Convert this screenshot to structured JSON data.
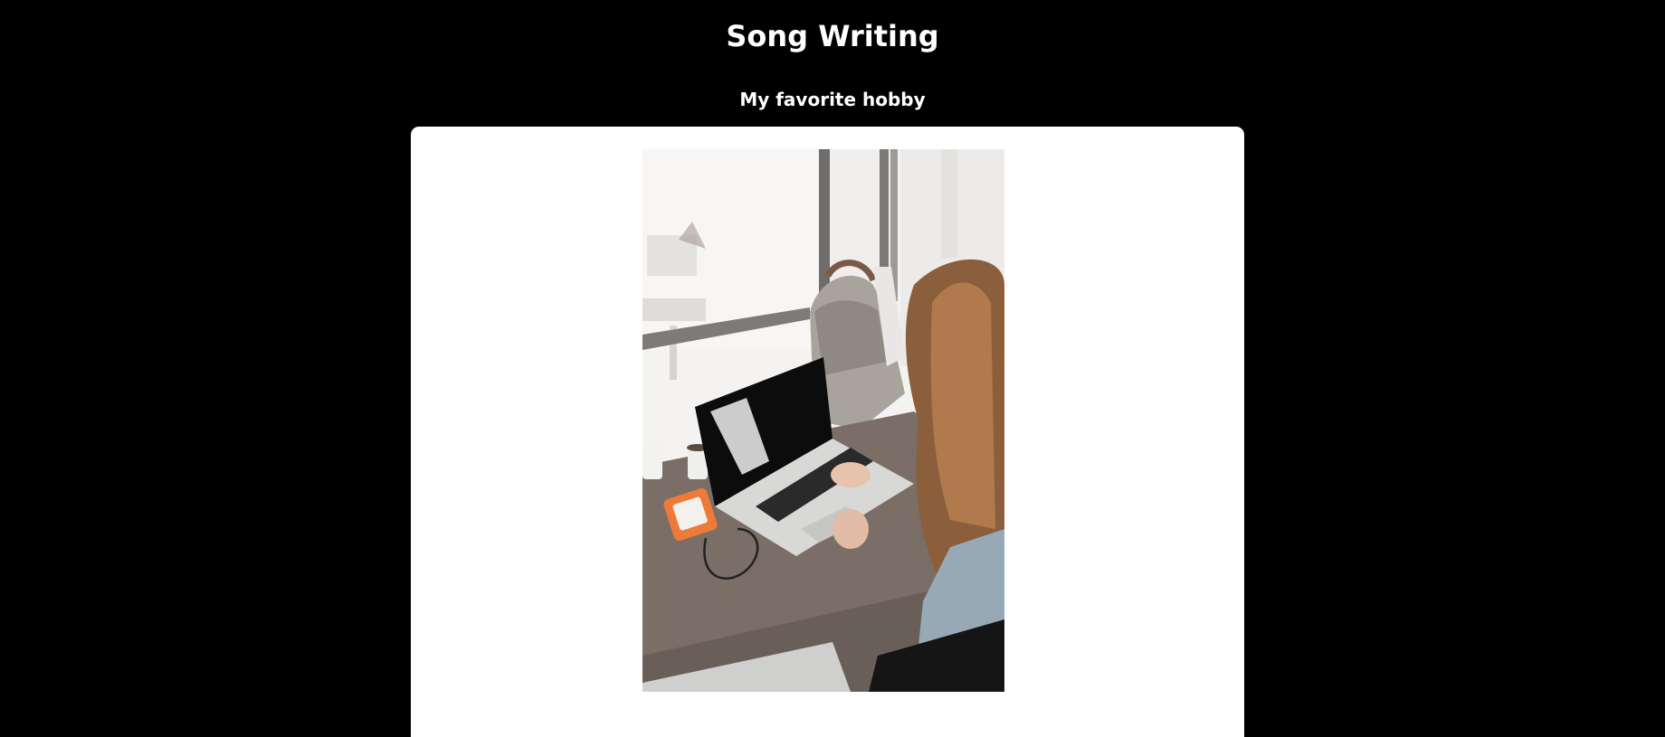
{
  "page": {
    "title": "Song Writing",
    "subtitle": "My favorite hobby"
  },
  "colors": {
    "background": "#000000",
    "text": "#ffffff",
    "card": "#ffffff"
  },
  "photo": {
    "alt": "Woman typing on a laptop at a wooden desk by a window"
  }
}
